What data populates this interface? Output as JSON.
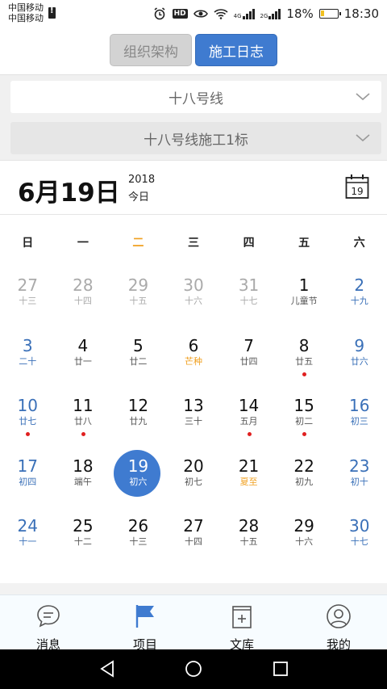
{
  "status": {
    "carrier1": "中国移动",
    "carrier2": "中国移动",
    "hd": "HD",
    "net1": "4G",
    "net2": "2G",
    "battery": "18%",
    "time": "18:30"
  },
  "tabs": [
    {
      "label": "组织架构",
      "active": false
    },
    {
      "label": "施工日志",
      "active": true
    }
  ],
  "selectors": {
    "line": "十八号线",
    "section": "十八号线施工1标"
  },
  "date_header": {
    "date": "6月19日",
    "year": "2018",
    "today": "今日",
    "cal_icon_day": "19"
  },
  "weekdays": [
    "日",
    "一",
    "二",
    "三",
    "四",
    "五",
    "六"
  ],
  "highlight_weekday": 2,
  "days": [
    {
      "n": "27",
      "l": "十三",
      "grey": true
    },
    {
      "n": "28",
      "l": "十四",
      "grey": true
    },
    {
      "n": "29",
      "l": "十五",
      "grey": true
    },
    {
      "n": "30",
      "l": "十六",
      "grey": true
    },
    {
      "n": "31",
      "l": "十七",
      "grey": true
    },
    {
      "n": "1",
      "l": "儿童节"
    },
    {
      "n": "2",
      "l": "十九"
    },
    {
      "n": "3",
      "l": "二十"
    },
    {
      "n": "4",
      "l": "廿一"
    },
    {
      "n": "5",
      "l": "廿二"
    },
    {
      "n": "6",
      "l": "芒种",
      "holiday": true
    },
    {
      "n": "7",
      "l": "廿四"
    },
    {
      "n": "8",
      "l": "廿五",
      "dot": true
    },
    {
      "n": "9",
      "l": "廿六"
    },
    {
      "n": "10",
      "l": "廿七",
      "dot": true
    },
    {
      "n": "11",
      "l": "廿八",
      "dot": true
    },
    {
      "n": "12",
      "l": "廿九"
    },
    {
      "n": "13",
      "l": "三十"
    },
    {
      "n": "14",
      "l": "五月",
      "dot": true
    },
    {
      "n": "15",
      "l": "初二",
      "dot": true
    },
    {
      "n": "16",
      "l": "初三"
    },
    {
      "n": "17",
      "l": "初四"
    },
    {
      "n": "18",
      "l": "端午"
    },
    {
      "n": "19",
      "l": "初六",
      "selected": true
    },
    {
      "n": "20",
      "l": "初七"
    },
    {
      "n": "21",
      "l": "夏至",
      "holiday": true
    },
    {
      "n": "22",
      "l": "初九"
    },
    {
      "n": "23",
      "l": "初十"
    },
    {
      "n": "24",
      "l": "十一"
    },
    {
      "n": "25",
      "l": "十二"
    },
    {
      "n": "26",
      "l": "十三"
    },
    {
      "n": "27",
      "l": "十四"
    },
    {
      "n": "28",
      "l": "十五"
    },
    {
      "n": "29",
      "l": "十六"
    },
    {
      "n": "30",
      "l": "十七"
    }
  ],
  "nav": [
    {
      "label": "消息",
      "icon": "message-icon"
    },
    {
      "label": "项目",
      "icon": "flag-icon"
    },
    {
      "label": "文库",
      "icon": "library-icon"
    },
    {
      "label": "我的",
      "icon": "profile-icon"
    }
  ],
  "colors": {
    "accent": "#3f7bd0",
    "weekend": "#3a70b8",
    "holiday": "#f0a020",
    "dot": "#e02020"
  }
}
